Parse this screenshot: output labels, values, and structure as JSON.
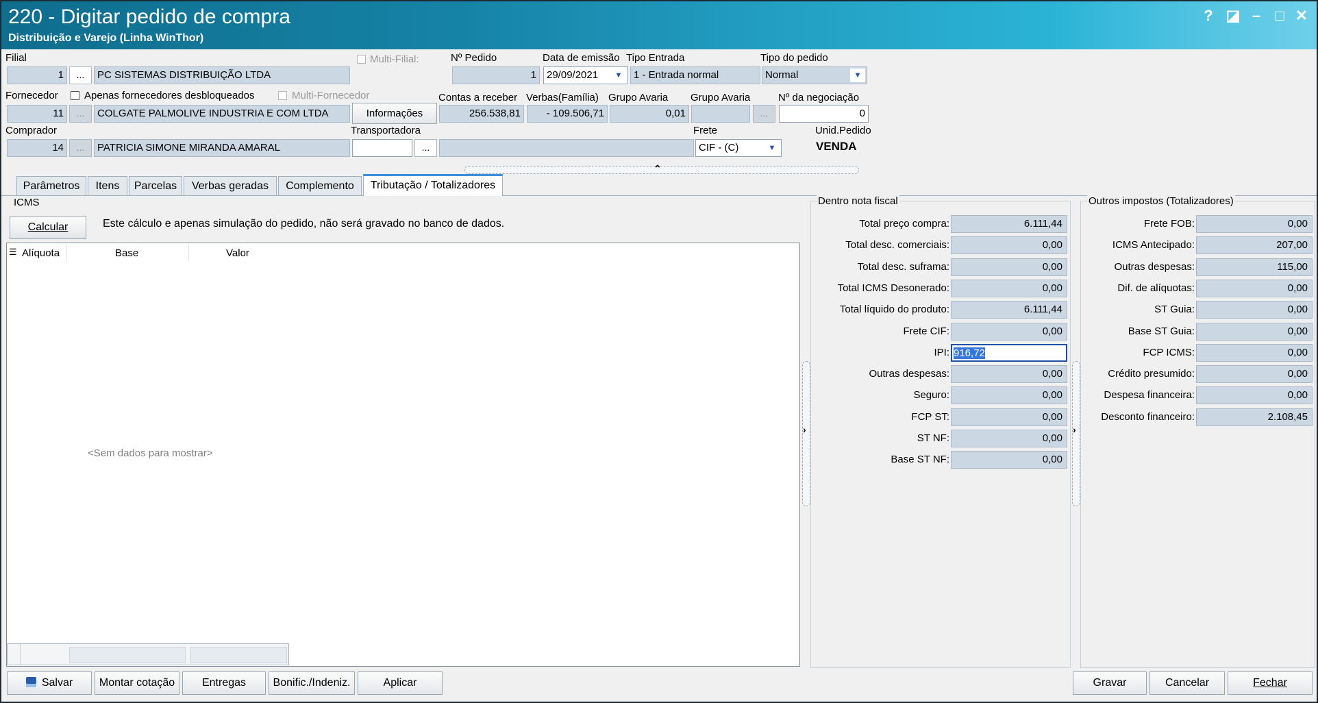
{
  "window": {
    "title": "220 - Digitar pedido de compra",
    "subtitle": "Distribuição e Varejo (Linha WinThor)",
    "controls": [
      "?",
      "◪",
      "–",
      "□",
      "✕"
    ]
  },
  "header": {
    "filial_label": "Filial",
    "filial_code": "1",
    "filial_name": "PC SISTEMAS DISTRIBUIÇÃO LTDA",
    "multi_filial_label": "Multi-Filial:",
    "nro_pedido_label": "Nº Pedido",
    "nro_pedido": "1",
    "data_emissao_label": "Data de emissão",
    "data_emissao": "29/09/2021",
    "tipo_entrada_label": "Tipo Entrada",
    "tipo_entrada": "1 - Entrada normal",
    "tipo_pedido_label": "Tipo do pedido",
    "tipo_pedido": "Normal",
    "fornecedor_label": "Fornecedor",
    "apenas_desbloqueados_label": "Apenas fornecedores desbloqueados",
    "multi_fornecedor_label": "Multi-Fornecedor",
    "fornecedor_code": "11",
    "fornecedor_name": "COLGATE PALMOLIVE INDUSTRIA  E COM LTDA",
    "informacoes_button": "Informações",
    "contas_receber_label": "Contas a receber",
    "contas_receber": "256.538,81",
    "verbas_label": "Verbas(Família)",
    "verbas": "- 109.506,71",
    "grupo_avaria1_label": "Grupo Avaria",
    "grupo_avaria1": "0,01",
    "grupo_avaria2_label": "Grupo Avaria",
    "grupo_avaria2": "",
    "negociacao_label": "Nº da negociação",
    "negociacao": "0",
    "comprador_label": "Comprador",
    "comprador_code": "14",
    "comprador_name": "PATRICIA SIMONE MIRANDA AMARAL",
    "transportadora_label": "Transportadora",
    "frete_label": "Frete",
    "frete": "CIF - (C)",
    "unid_pedido_label": "Unid.Pedido",
    "unid_pedido": "VENDA",
    "ellipsis": "..."
  },
  "tabs": [
    {
      "label": "Parâmetros"
    },
    {
      "label": "Itens"
    },
    {
      "label": "Parcelas"
    },
    {
      "label": "Verbas geradas"
    },
    {
      "label": "Complemento"
    },
    {
      "label": "Tributação / Totalizadores",
      "active": true
    }
  ],
  "icms": {
    "group_label": "ICMS",
    "calcular_button": "Calcular",
    "notice": "Este cálculo e apenas  simulação do pedido, não será gravado no banco de dados.",
    "columns": [
      "Alíquota",
      "Base",
      "Valor"
    ],
    "empty_text": "<Sem dados para mostrar>"
  },
  "dentro_nota": {
    "group_label": "Dentro nota fiscal",
    "rows": [
      {
        "label": "Total preço compra:",
        "value": "6.111,44"
      },
      {
        "label": "Total desc. comerciais:",
        "value": "0,00"
      },
      {
        "label": "Total desc. suframa:",
        "value": "0,00"
      },
      {
        "label": "Total ICMS Desonerado:",
        "value": "0,00"
      },
      {
        "label": "Total líquido do produto:",
        "value": "6.111,44"
      },
      {
        "label": "Frete CIF:",
        "value": "0,00"
      },
      {
        "label": "IPI:",
        "value": "916,72",
        "selected": true
      },
      {
        "label": "Outras despesas:",
        "value": "0,00"
      },
      {
        "label": "Seguro:",
        "value": "0,00"
      },
      {
        "label": "FCP ST:",
        "value": "0,00"
      },
      {
        "label": "ST NF:",
        "value": "0,00"
      },
      {
        "label": "Base ST NF:",
        "value": "0,00"
      }
    ]
  },
  "outros_impostos": {
    "group_label": "Outros impostos (Totalizadores)",
    "rows": [
      {
        "label": "Frete FOB:",
        "value": "0,00"
      },
      {
        "label": "ICMS Antecipado:",
        "value": "207,00"
      },
      {
        "label": "Outras despesas:",
        "value": "115,00"
      },
      {
        "label": "Dif. de alíquotas:",
        "value": "0,00"
      },
      {
        "label": "ST Guia:",
        "value": "0,00"
      },
      {
        "label": "Base ST Guia:",
        "value": "0,00"
      },
      {
        "label": "FCP ICMS:",
        "value": "0,00"
      },
      {
        "label": "Crédito presumido:",
        "value": "0,00"
      },
      {
        "label": "Despesa financeira:",
        "value": "0,00"
      },
      {
        "label": "Desconto financeiro:",
        "value": "2.108,45"
      }
    ]
  },
  "footer": {
    "salvar": "Salvar",
    "montar_cotacao": "Montar cotação",
    "entregas": "Entregas",
    "bonific": "Bonific./Indeniz.",
    "aplicar": "Aplicar",
    "gravar": "Gravar",
    "cancelar": "Cancelar",
    "fechar": "Fechar"
  }
}
